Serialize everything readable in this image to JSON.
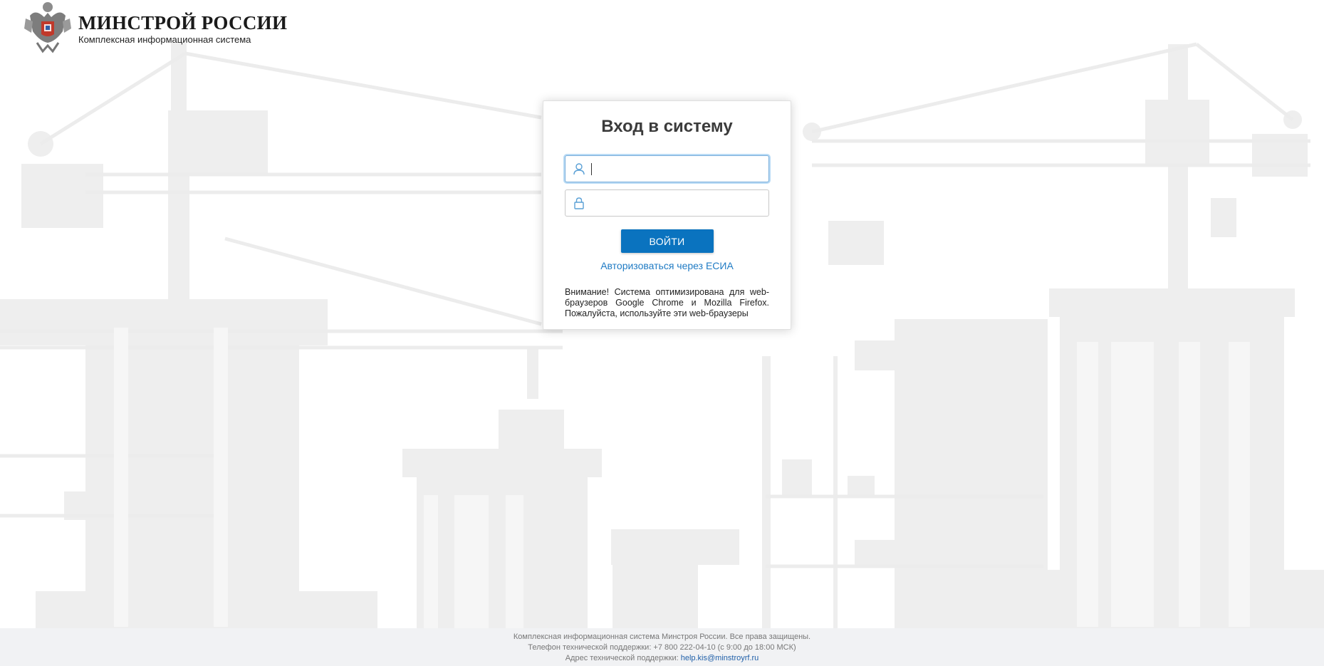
{
  "brand": {
    "title": "МИНСТРОЙ РОССИИ",
    "subtitle": "Комплексная информационная система",
    "emblem_icon": "coat-of-arms-emblem"
  },
  "login": {
    "title": "Вход в систему",
    "username_value": "",
    "password_value": "",
    "submit_label": "ВОЙТИ",
    "esia_link": "Авторизоваться через ЕСИА",
    "notice": "Внимание! Система оптимизирована для web-браузеров Google Chrome и Mozilla Firefox. Пожалуйста, используйте эти web-браузеры"
  },
  "footer": {
    "line1": "Комплексная информационная система Минстроя России. Все права защищены.",
    "line2": "Телефон технической поддержки: +7 800 222-04-10 (с 9:00 до 18:00 МСК)",
    "line3_prefix": "Адрес технической поддержки:",
    "email": "help.kis@minstroyrf.ru"
  },
  "icons": {
    "user": "user-icon",
    "lock": "lock-icon"
  },
  "colors": {
    "accent": "#0a73bf",
    "link": "#1f7bc4",
    "footer_bg": "#f1f2f4",
    "footer_link": "#1f5fa8"
  }
}
